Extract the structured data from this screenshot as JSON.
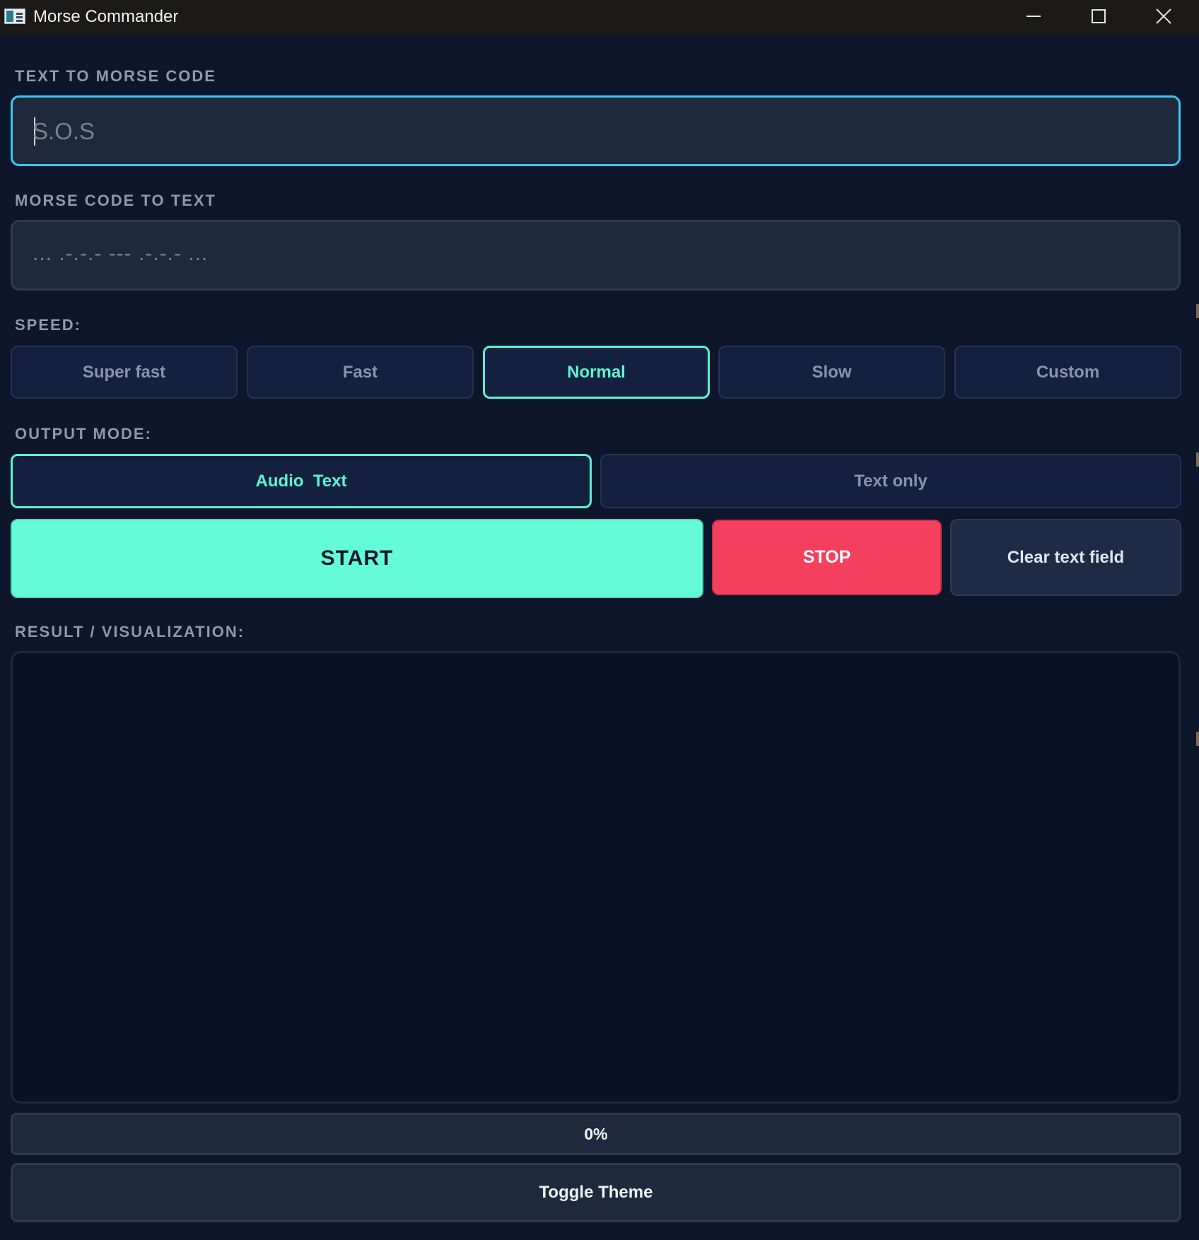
{
  "window": {
    "title": "Morse Commander"
  },
  "text_to_morse": {
    "label": "TEXT TO MORSE CODE",
    "placeholder": "S.O.S"
  },
  "morse_to_text": {
    "label": "MORSE CODE TO TEXT",
    "placeholder": "... .-.-.- --- .-.-.- ..."
  },
  "speed": {
    "label": "SPEED:",
    "options": [
      "Super fast",
      "Fast",
      "Normal",
      "Slow",
      "Custom"
    ],
    "selected": "Normal"
  },
  "output_mode": {
    "label": "OUTPUT MODE:",
    "options": [
      "Audio  Text",
      "Text only"
    ],
    "selected": "Audio  Text"
  },
  "actions": {
    "start": "START",
    "stop": "STOP",
    "clear": "Clear text field"
  },
  "result": {
    "label": "RESULT / VISUALIZATION:"
  },
  "progress": {
    "value": 0,
    "text": "0%"
  },
  "theme": {
    "toggle_label": "Toggle Theme"
  },
  "colors": {
    "background": "#0d162b",
    "accent": "#5ef2d4",
    "start": "#64fbd8",
    "stop": "#f43f5e",
    "focus_border": "#3bc6f2"
  },
  "icons": {
    "app": "morse-commander-app-icon",
    "minimize": "minimize-icon",
    "maximize": "maximize-icon",
    "close": "close-icon"
  }
}
